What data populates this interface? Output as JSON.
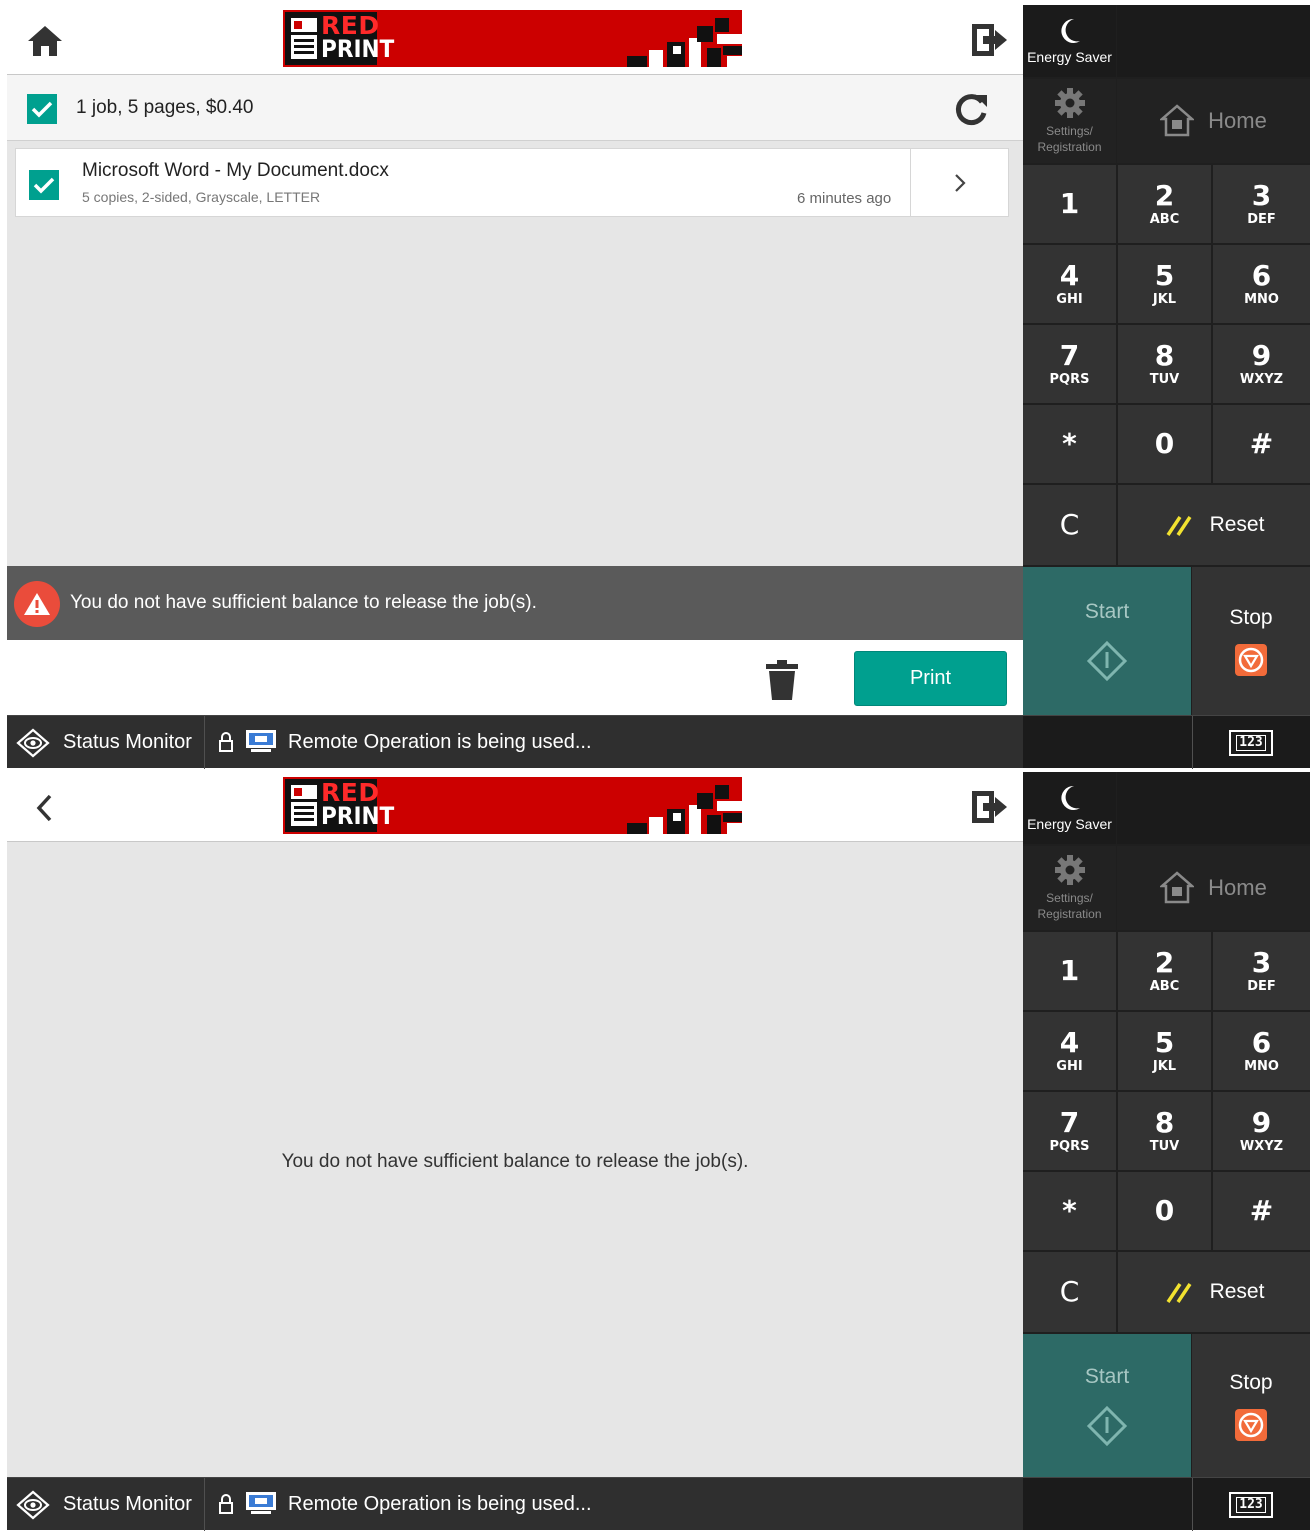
{
  "logo": {
    "line1": "RED",
    "line2": "PRINT"
  },
  "job_list": {
    "summary": "1 job, 5 pages, $0.40",
    "jobs": [
      {
        "title": "Microsoft Word - My Document.docx",
        "details": "5 copies, 2-sided, Grayscale, LETTER",
        "time": "6 minutes ago",
        "selected": true
      }
    ],
    "alert": "You do not have sufficient balance to release the job(s).",
    "print_label": "Print"
  },
  "job_detail": {
    "message": "You do not have sufficient balance to release the job(s)."
  },
  "status_bar": {
    "status_monitor": "Status Monitor",
    "remote_operation": "Remote Operation is being used..."
  },
  "side_panel": {
    "energy_saver": "Energy Saver",
    "settings": "Settings/ Registration",
    "home": "Home",
    "keys": [
      {
        "digit": "1",
        "letters": ""
      },
      {
        "digit": "2",
        "letters": "ABC"
      },
      {
        "digit": "3",
        "letters": "DEF"
      },
      {
        "digit": "4",
        "letters": "GHI"
      },
      {
        "digit": "5",
        "letters": "JKL"
      },
      {
        "digit": "6",
        "letters": "MNO"
      },
      {
        "digit": "7",
        "letters": "PQRS"
      },
      {
        "digit": "8",
        "letters": "TUV"
      },
      {
        "digit": "9",
        "letters": "WXYZ"
      },
      {
        "digit": "*",
        "letters": ""
      },
      {
        "digit": "0",
        "letters": ""
      },
      {
        "digit": "#",
        "letters": ""
      }
    ],
    "clear": "C",
    "reset": "Reset",
    "start": "Start",
    "stop": "Stop",
    "keypad_toggle": "123"
  },
  "colors": {
    "accent": "#00a08f",
    "brand": "#cc0000",
    "warning": "#ea4c3b",
    "stop": "#f26b3a",
    "start": "#2d6a66",
    "reset_slash": "#f2e230"
  }
}
